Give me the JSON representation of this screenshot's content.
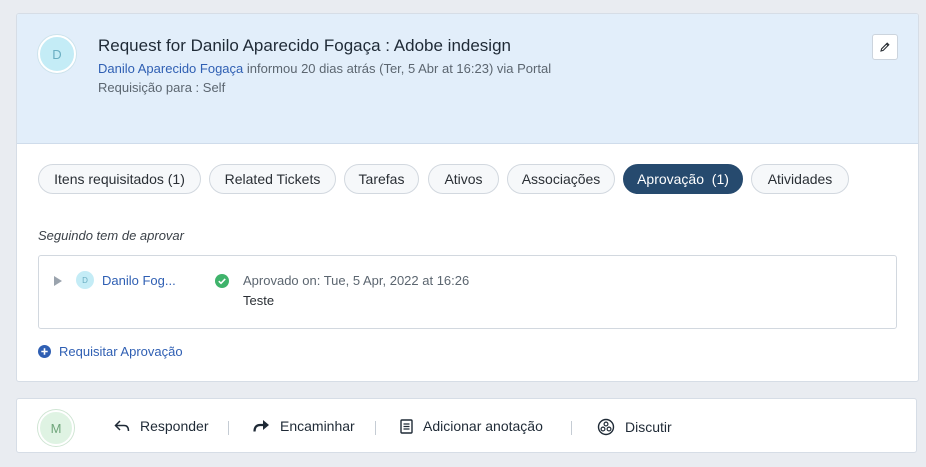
{
  "header": {
    "avatar_initial": "D",
    "title": "Request for Danilo Aparecido Fogaça : Adobe indesign",
    "requester_name": "Danilo Aparecido Fogaça",
    "meta_text": " informou 20 dias atrás (Ter, 5 Abr at 16:23) via Portal",
    "requisition_for": "Requisição para : Self",
    "edit_icon": "pencil-icon"
  },
  "tabs": [
    {
      "label": "Itens requisitados (1)",
      "active": false
    },
    {
      "label": "Related Tickets",
      "active": false
    },
    {
      "label": "Tarefas",
      "active": false
    },
    {
      "label": "Ativos",
      "active": false
    },
    {
      "label": "Associações",
      "active": false
    },
    {
      "label": "Aprovação  (1)",
      "active": true
    },
    {
      "label": "Atividades",
      "active": false
    }
  ],
  "approval": {
    "section_label": "Seguindo tem de aprovar",
    "approver_initial": "D",
    "approver_name": "Danilo Fog...",
    "status_text": "Aprovado on: Tue, 5 Apr, 2022 at 16:26",
    "comment": "Teste",
    "request_approval_label": "Requisitar Aprovação"
  },
  "footer": {
    "avatar_initial": "M",
    "actions": [
      {
        "label": "Responder",
        "icon": "reply-icon"
      },
      {
        "label": "Encaminhar",
        "icon": "forward-icon"
      },
      {
        "label": "Adicionar anotação",
        "icon": "note-icon"
      },
      {
        "label": "Discutir",
        "icon": "discuss-icon"
      }
    ]
  },
  "colors": {
    "accent": "#264a6e",
    "link": "#2f5fb3",
    "success": "#3fb36b",
    "header_bg": "#e2eefa"
  }
}
